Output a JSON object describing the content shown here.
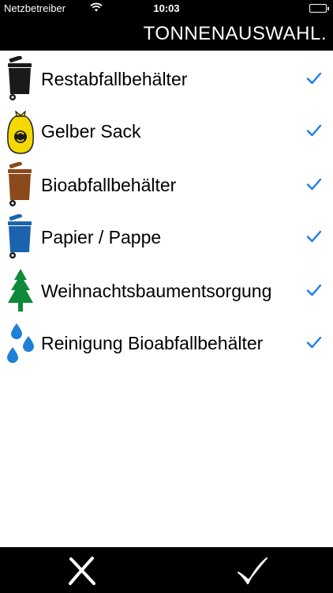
{
  "status_bar": {
    "carrier": "Netzbetreiber",
    "time": "10:03"
  },
  "header": {
    "title": "TONNENAUSWAHL."
  },
  "bins": [
    {
      "label": "Restabfallbehälter",
      "icon": "black-bin-icon",
      "color": "#1a1a1a",
      "checked": true
    },
    {
      "label": "Gelber Sack",
      "icon": "yellow-bag-icon",
      "color": "#f5d800",
      "checked": true
    },
    {
      "label": "Bioabfallbehälter",
      "icon": "brown-bin-icon",
      "color": "#8a4a1c",
      "checked": true
    },
    {
      "label": "Papier / Pappe",
      "icon": "blue-bin-icon",
      "color": "#1c63ad",
      "checked": true
    },
    {
      "label": "Weihnachtsbaumentsorgung",
      "icon": "christmas-tree-icon",
      "color": "#0f8a3a",
      "checked": true
    },
    {
      "label": "Reinigung Bioabfallbehälter",
      "icon": "water-drops-icon",
      "color": "#1f7fd6",
      "checked": true
    }
  ],
  "toolbar": {
    "cancel_icon": "x-icon",
    "confirm_icon": "checkmark-icon"
  },
  "colors": {
    "check_accent": "#1b7bf2",
    "bars": "#000000",
    "background": "#ffffff"
  }
}
